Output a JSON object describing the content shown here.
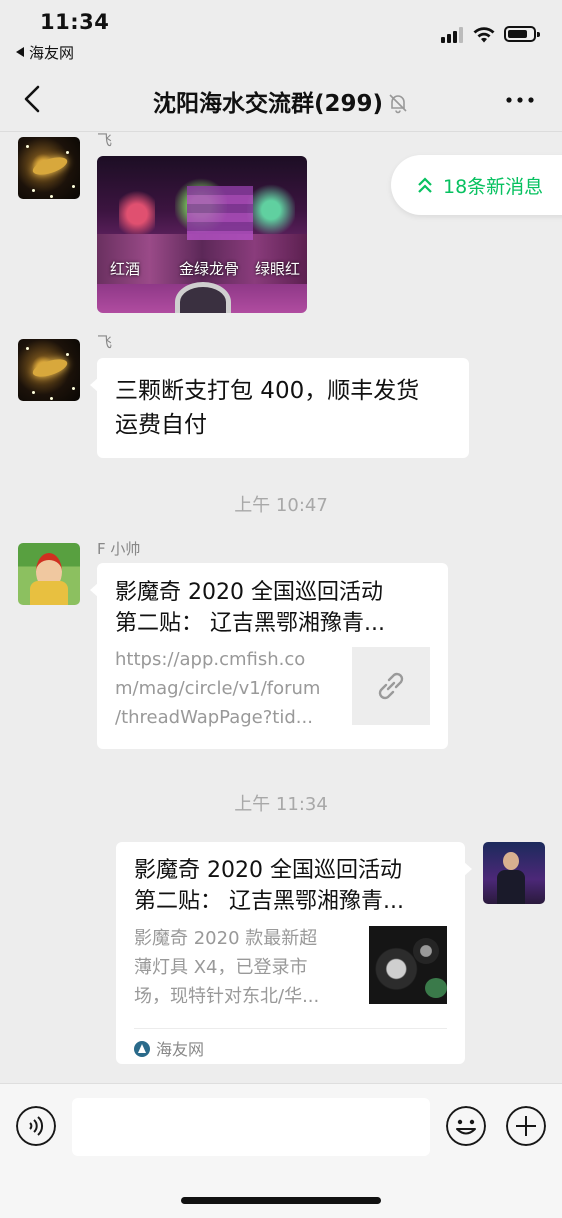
{
  "status_bar": {
    "time": "11:34",
    "back_app": "海友网"
  },
  "nav": {
    "title": "沈阳海水交流群(299)"
  },
  "new_messages": {
    "label": "18条新消息"
  },
  "messages": {
    "m1": {
      "sender": "飞",
      "image_captions": [
        "红酒",
        "金绿龙骨",
        "绿眼红"
      ]
    },
    "m2": {
      "sender": "飞",
      "text_lines": [
        "三颗断支打包 400，顺丰发货",
        "运费自付"
      ]
    },
    "ts1": "上午 10:47",
    "m3": {
      "sender": "F 小帅",
      "title_lines": [
        "影魔奇 2020 全国巡回活动",
        "第二贴： 辽吉黑鄂湘豫青..."
      ],
      "url_lines": [
        "https://app.cmfish.co",
        "m/mag/circle/v1/forum",
        "/threadWapPage?tid..."
      ]
    },
    "ts2": "上午 11:34",
    "m4": {
      "title_lines": [
        "影魔奇 2020 全国巡回活动",
        "第二贴： 辽吉黑鄂湘豫青..."
      ],
      "desc_lines": [
        "影魔奇 2020 款最新超",
        "薄灯具 X4，已登录市",
        "场，现特针对东北/华..."
      ],
      "source": "海友网"
    }
  },
  "colors": {
    "accent_green": "#07c160",
    "background": "#ededed",
    "bubble": "#ffffff"
  }
}
